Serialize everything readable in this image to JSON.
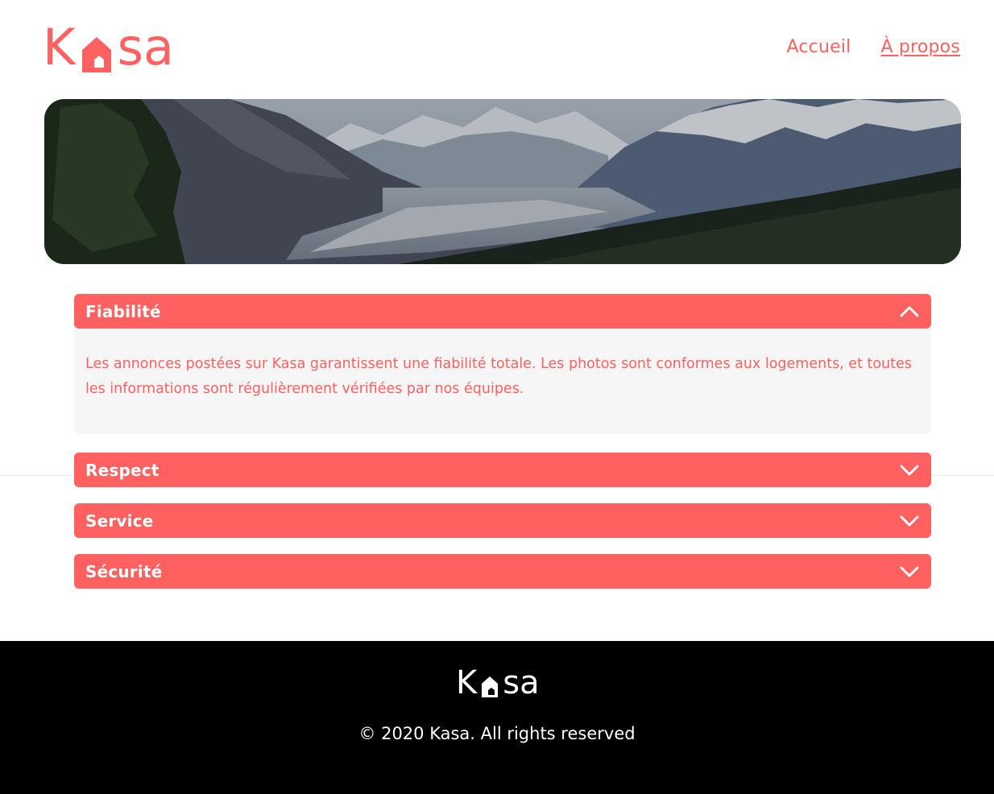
{
  "brand": {
    "logo_letters": [
      "K",
      "sa"
    ],
    "accent_color": "#FF6060"
  },
  "nav": {
    "items": [
      {
        "label": "Accueil",
        "active": false
      },
      {
        "label": "À propos",
        "active": true
      }
    ]
  },
  "banner": {
    "image": "mountain-valley-landscape"
  },
  "accordion": {
    "items": [
      {
        "title": "Fiabilité",
        "expanded": true,
        "icon": "chevron-up-icon",
        "content": "Les annonces postées sur Kasa garantissent une fiabilité totale. Les photos sont conformes aux logements, et toutes les informations sont régulièrement vérifiées par nos équipes."
      },
      {
        "title": "Respect",
        "expanded": false,
        "icon": "chevron-down-icon"
      },
      {
        "title": "Service",
        "expanded": false,
        "icon": "chevron-down-icon"
      },
      {
        "title": "Sécurité",
        "expanded": false,
        "icon": "chevron-down-icon"
      }
    ]
  },
  "footer": {
    "logo_letters": [
      "K",
      "sa"
    ],
    "copyright": "© 2020 Kasa. All rights reserved"
  }
}
